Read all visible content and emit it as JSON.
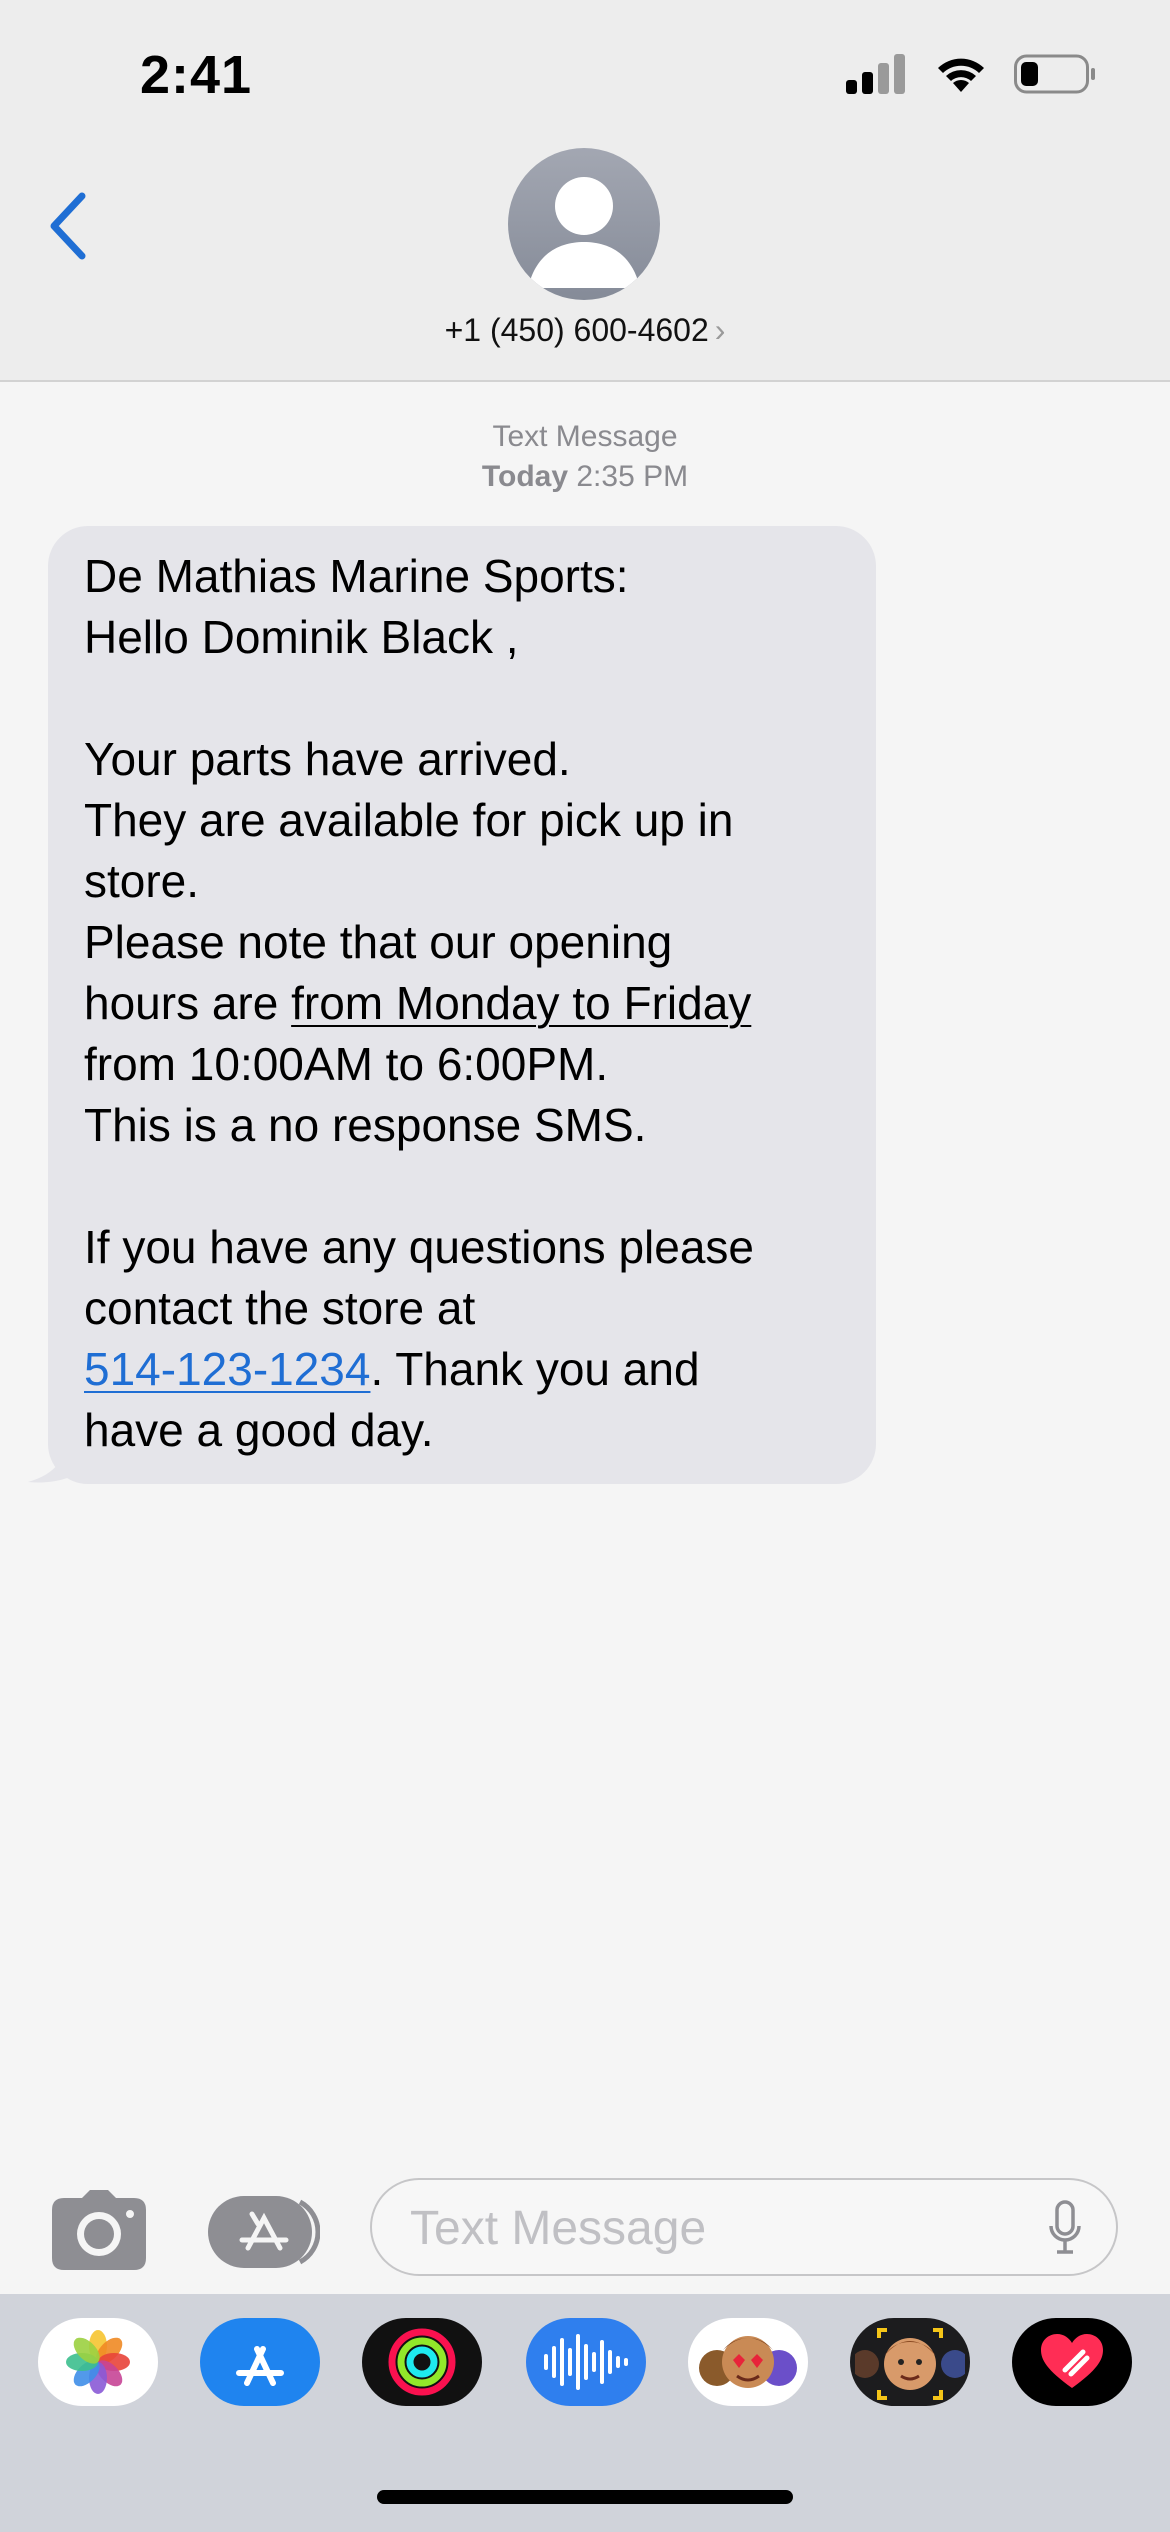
{
  "status_bar": {
    "time": "2:41"
  },
  "header": {
    "contact": "+1 (450) 600-4602",
    "chevron": "›"
  },
  "thread": {
    "service_label": "Text Message",
    "timestamp_day": "Today",
    "timestamp_time": "2:35 PM"
  },
  "message": {
    "line1": "De Mathias Marine Sports:",
    "line2": "Hello Dominik Black ,",
    "line3": "Your parts have arrived.",
    "line4": "They are available for pick up in",
    "line5": "store.",
    "line6": "Please note that our opening",
    "line7_prefix": "hours are ",
    "line7_link": "from Monday to Friday",
    "line8": "from 10:00AM to 6:00PM.",
    "line9": "This is a no response SMS.",
    "line10": "If you have any questions please",
    "line11": "contact the store at",
    "line12_phone": "514-123-1234",
    "line12_suffix": ". Thank you and",
    "line13": "have a good day."
  },
  "compose": {
    "placeholder": "Text Message"
  },
  "apps": [
    "photos-icon",
    "app-store-icon",
    "activity-icon",
    "audio-message-icon",
    "animoji-icon",
    "memoji-icon",
    "digital-touch-icon"
  ],
  "colors": {
    "accent": "#1f6ed4",
    "bubble": "#e5e5ea",
    "background": "#f5f5f5",
    "header": "#ededed",
    "drawer": "#d0d3da"
  }
}
